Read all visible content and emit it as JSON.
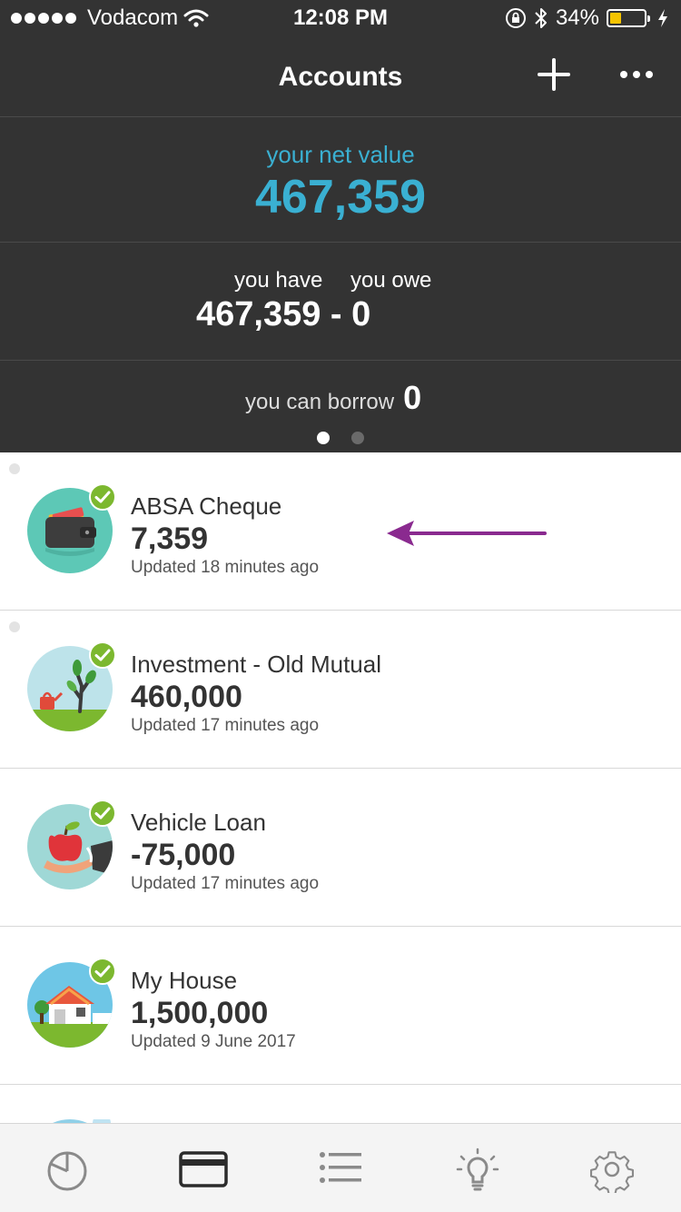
{
  "status_bar": {
    "carrier": "Vodacom",
    "time": "12:08 PM",
    "battery": "34%",
    "battery_level": 0.34,
    "icons": [
      "signal-dots-icon",
      "wifi-icon",
      "orientation-lock-icon",
      "bluetooth-icon",
      "battery-icon",
      "charging-icon"
    ]
  },
  "header": {
    "title": "Accounts",
    "add_icon": "plus-icon",
    "more_icon": "more-dots-icon"
  },
  "summary": {
    "net_label": "your net value",
    "net_value": "467,359",
    "have_label": "you have",
    "owe_label": "you owe",
    "have_owe_value": "467,359 - 0",
    "borrow_label": "you can borrow",
    "borrow_value": "0",
    "page_count": 2,
    "active_page": 1
  },
  "accounts": [
    {
      "name": "ABSA Cheque",
      "amount": "7,359",
      "updated": "Updated 18 minutes ago",
      "icon": "wallet-icon",
      "synced": true,
      "unread": true,
      "annotation": "purple-arrow-icon"
    },
    {
      "name": "Investment - Old Mutual",
      "amount": "460,000",
      "updated": "Updated 17 minutes ago",
      "icon": "tree-icon",
      "synced": true,
      "unread": true
    },
    {
      "name": "Vehicle Loan",
      "amount": "-75,000",
      "updated": "Updated 17 minutes ago",
      "icon": "apple-hand-icon",
      "synced": true,
      "unread": false
    },
    {
      "name": "My House",
      "amount": "1,500,000",
      "updated": "Updated 9 June 2017",
      "icon": "house-icon",
      "synced": true,
      "unread": false
    }
  ],
  "tabs": [
    {
      "name": "overview",
      "icon": "pie-chart-icon"
    },
    {
      "name": "accounts",
      "icon": "card-icon",
      "active": true
    },
    {
      "name": "transactions",
      "icon": "list-icon"
    },
    {
      "name": "insights",
      "icon": "lightbulb-icon"
    },
    {
      "name": "settings",
      "icon": "gear-icon"
    }
  ],
  "colors": {
    "header_bg": "#333333",
    "accent": "#3ab0d2",
    "check_green": "#7cb82f",
    "arrow_purple": "#8a2a8f",
    "tab_bar_bg": "#f4f4f4"
  }
}
